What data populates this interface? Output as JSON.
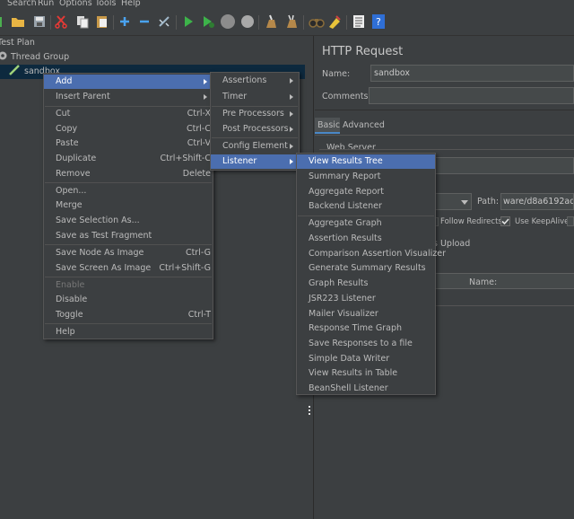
{
  "menubar": [
    "Search",
    "Run",
    "Options",
    "Tools",
    "Help"
  ],
  "tree": {
    "test_plan": "Test Plan",
    "thread_group": "Thread Group",
    "sandbox": "sandbox"
  },
  "panel": {
    "title": "HTTP Request",
    "name_label": "Name:",
    "name_value": "sandbox",
    "comments_label": "Comments:",
    "tab_basic": "Basic",
    "tab_advanced": "Advanced",
    "web_server": "Web Server",
    "path_label": "Path:",
    "path_value": "ware/d8a6192ade3",
    "follow_redirects": "Follow Redirects",
    "use_keepalive": "Use KeepAlive",
    "upload_fragment": "s Upload",
    "name_col": "Name:"
  },
  "context_menu": {
    "items": [
      {
        "label": "Add"
      },
      {
        "label": "Insert Parent"
      },
      {
        "label": "Cut",
        "shortcut": "Ctrl-X"
      },
      {
        "label": "Copy",
        "shortcut": "Ctrl-C"
      },
      {
        "label": "Paste",
        "shortcut": "Ctrl-V"
      },
      {
        "label": "Duplicate",
        "shortcut": "Ctrl+Shift-C"
      },
      {
        "label": "Remove",
        "shortcut": "Delete"
      },
      {
        "label": "Open..."
      },
      {
        "label": "Merge"
      },
      {
        "label": "Save Selection As..."
      },
      {
        "label": "Save as Test Fragment"
      },
      {
        "label": "Save Node As Image",
        "shortcut": "Ctrl-G"
      },
      {
        "label": "Save Screen As Image",
        "shortcut": "Ctrl+Shift-G"
      },
      {
        "label": "Enable"
      },
      {
        "label": "Disable"
      },
      {
        "label": "Toggle",
        "shortcut": "Ctrl-T"
      },
      {
        "label": "Help"
      }
    ]
  },
  "add_menu": {
    "items": [
      "Assertions",
      "Timer",
      "Pre Processors",
      "Post Processors",
      "Config Element",
      "Listener"
    ]
  },
  "listener_menu": {
    "items": [
      "View Results Tree",
      "Summary Report",
      "Aggregate Report",
      "Backend Listener",
      "Aggregate Graph",
      "Assertion Results",
      "Comparison Assertion Visualizer",
      "Generate Summary Results",
      "Graph Results",
      "JSR223 Listener",
      "Mailer Visualizer",
      "Response Time Graph",
      "Save Responses to a file",
      "Simple Data Writer",
      "View Results in Table",
      "BeanShell Listener"
    ]
  },
  "colors": {
    "background": "#3c3f41",
    "selection": "#4b6eaf",
    "text": "#bbbbbb"
  }
}
